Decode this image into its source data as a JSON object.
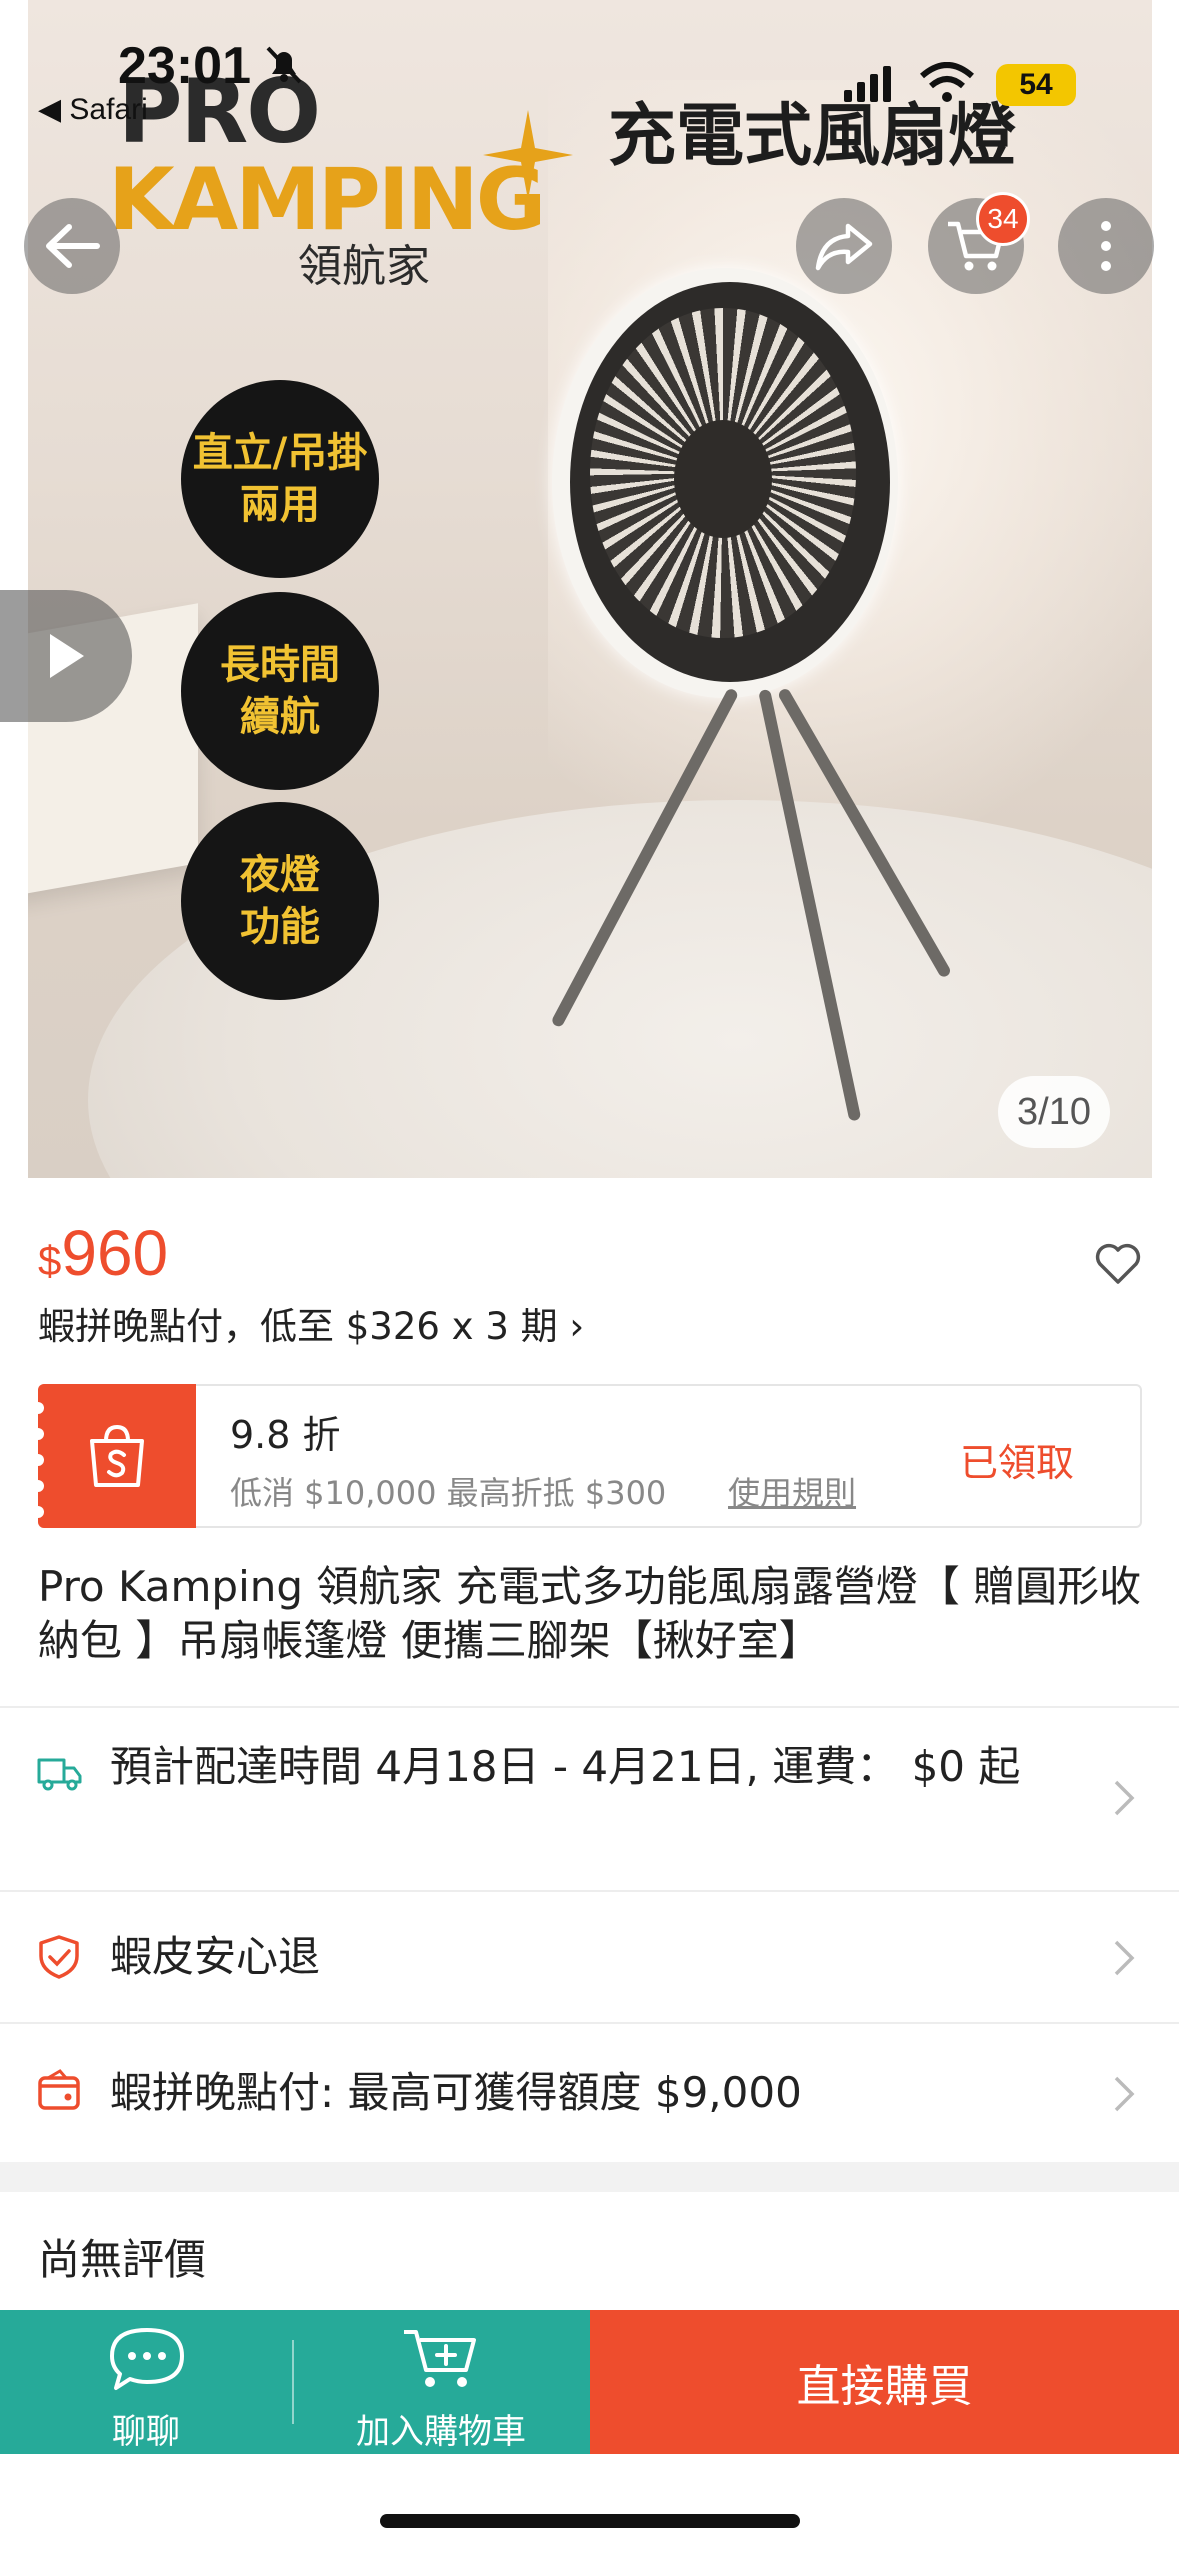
{
  "status_bar": {
    "time": "23:01",
    "back_app": "◀ Safari",
    "battery": "54"
  },
  "hero": {
    "logo_line1": "PRO",
    "logo_line2": "KAMPING",
    "logo_sub": "領航家",
    "headline": "充電式風扇燈",
    "badges": [
      "直立/吊掛\n兩用",
      "長時間\n續航",
      "夜燈\n功能"
    ],
    "slide_counter": "3/10"
  },
  "nav": {
    "cart_count": "34"
  },
  "price": {
    "currency": "$",
    "amount": "960"
  },
  "paylater_line": "蝦拼晚點付，低至 $326 x 3 期 ›",
  "coupon": {
    "title": "9.8 折",
    "desc": "低消 $10,000 最高折抵 $300",
    "rules": "使用規則",
    "status": "已領取"
  },
  "product_title": "Pro Kamping 領航家 充電式多功能風扇露營燈【 贈圓形收納包 】吊扇帳篷燈 便攜三腳架【揪好室】",
  "rows": [
    {
      "text": "預計配達時間 4月18日 - 4月21日, 運費： $0 起"
    },
    {
      "text": "蝦皮安心退"
    },
    {
      "text": "蝦拼晚點付: 最高可獲得額度 $9,000"
    }
  ],
  "reviews_title": "尚無評價",
  "bottom_bar": {
    "chat_label": "聊聊",
    "cart_label": "加入購物車",
    "buy_label": "直接購買"
  },
  "colors": {
    "brand": "#ee4d2d",
    "teal": "#26aa99",
    "badge_bg": "#151515",
    "badge_text": "#f1c232"
  },
  "icons": [
    "back-arrow-icon",
    "share-icon",
    "cart-icon",
    "more-icon",
    "play-icon",
    "heart-icon",
    "shopee-bag-icon",
    "truck-icon",
    "shield-icon",
    "wallet-icon",
    "chevron-right-icon",
    "chat-icon",
    "add-cart-icon"
  ]
}
